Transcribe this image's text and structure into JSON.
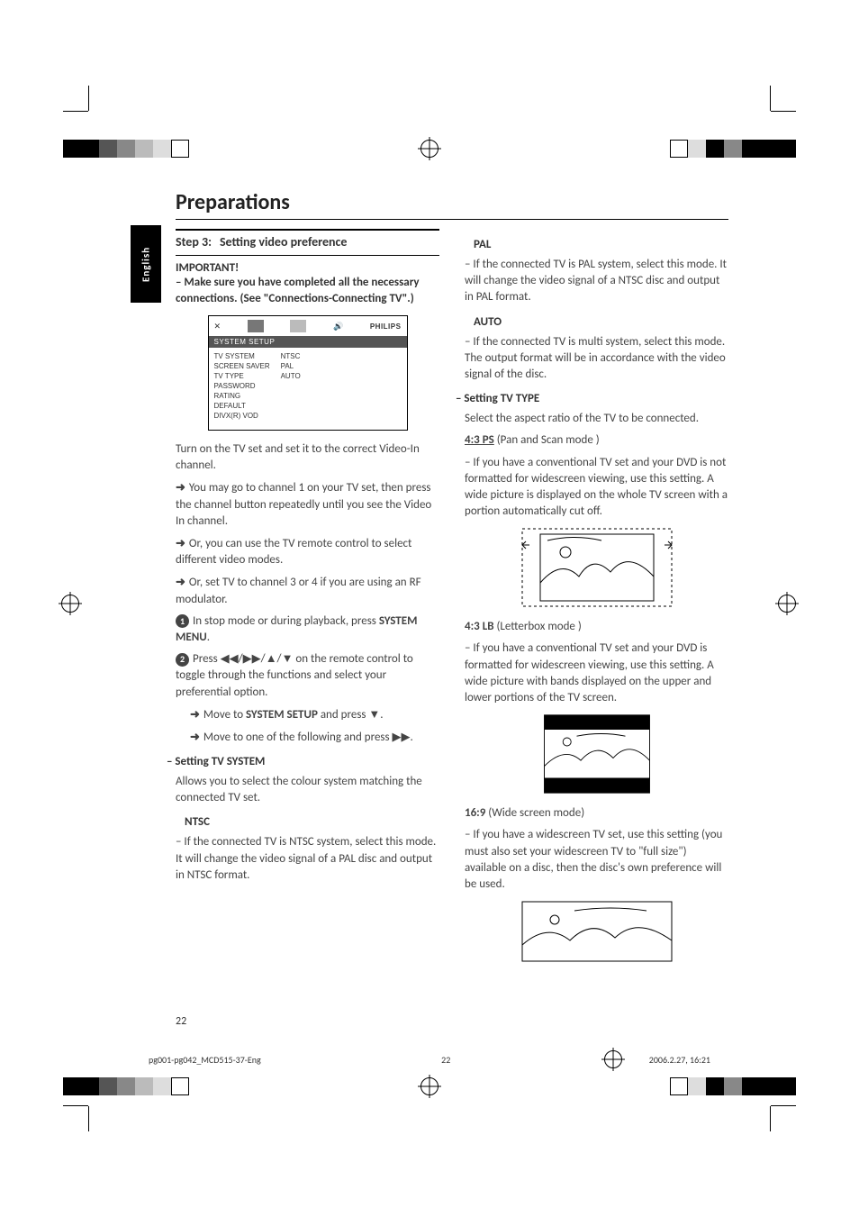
{
  "language_tab": "English",
  "page_title": "Preparations",
  "step": {
    "label": "Step 3:",
    "title": "Setting video preference"
  },
  "left": {
    "important_label": "IMPORTANT!",
    "important_body": "–  Make sure you have completed all the necessary connections. (See \"Connections-Connecting TV\".)",
    "menu": {
      "logo": "PHILIPS",
      "bar": "SYSTEM SETUP",
      "left_items": [
        "TV SYSTEM",
        "SCREEN SAVER",
        "TV TYPE",
        "PASSWORD",
        "RATING",
        "DEFAULT",
        "DIVX(R) VOD"
      ],
      "right_items": [
        "NTSC",
        "PAL",
        "AUTO"
      ]
    },
    "p1": "Turn on the TV set and set it to the correct Video-In channel.",
    "p2": "You may go to channel 1 on your TV set, then press the channel button repeatedly until you see the Video In channel.",
    "p3": "Or, you can use the TV remote control to select different video modes.",
    "p4": "Or, set TV to channel 3 or 4 if you are using an RF modulator.",
    "step1a": "In stop mode or during playback, press ",
    "step1b": "SYSTEM MENU",
    "step1c": ".",
    "step2a": "Press ",
    "step2b": "◀◀/▶▶/▲/▼",
    "step2c": " on the remote control to toggle through the functions and select your preferential option.",
    "move1a": "Move to ",
    "move1b": "SYSTEM SETUP",
    "move1c": " and press ▼.",
    "move2": "Move to one of the following and press ▶▶.",
    "tvsystem_h": "–   Setting TV SYSTEM",
    "tvsystem_body": "Allows you to select the colour system matching the connected TV set.",
    "ntsc_h": "NTSC",
    "ntsc_body": "–   If the connected TV is NTSC system, select this mode. It will change the video signal of a PAL disc and output in NTSC format."
  },
  "right": {
    "pal_h": "PAL",
    "pal_body": "–   If the connected TV is PAL system, select this mode. It will change the video signal of a NTSC disc and output in PAL format.",
    "auto_h": "AUTO",
    "auto_body": "–   If the connected TV is multi system, select this mode. The output format will be in accordance with the video signal of the disc.",
    "tvtype_h": "–   Setting TV TYPE",
    "tvtype_intro": "Select the aspect ratio of the TV to be connected.",
    "ps_label": "4:3 PS",
    "ps_mode": " (Pan and Scan mode )",
    "ps_body": "–   If you have a conventional TV set and your DVD is not formatted for widescreen viewing, use this setting.  A wide picture is displayed on the whole TV screen with a portion automatically cut off.",
    "lb_label": "4:3 LB",
    "lb_mode": " (Letterbox mode )",
    "lb_body": "–   If you have a conventional TV set and your DVD is formatted for widescreen viewing, use this setting.  A wide picture with bands displayed on the upper and lower portions of the TV screen.",
    "ws_label": "16:9",
    "ws_mode": " (Wide screen mode)",
    "ws_body": "–   If you have a widescreen TV set, use this setting (you must also set your widescreen TV to \"full size\") available on a disc, then the disc's own preference will be used."
  },
  "page_number": "22",
  "footer": {
    "left": "pg001-pg042_MCD515-37-Eng",
    "center": "22",
    "right": "2006.2.27, 16:21"
  }
}
